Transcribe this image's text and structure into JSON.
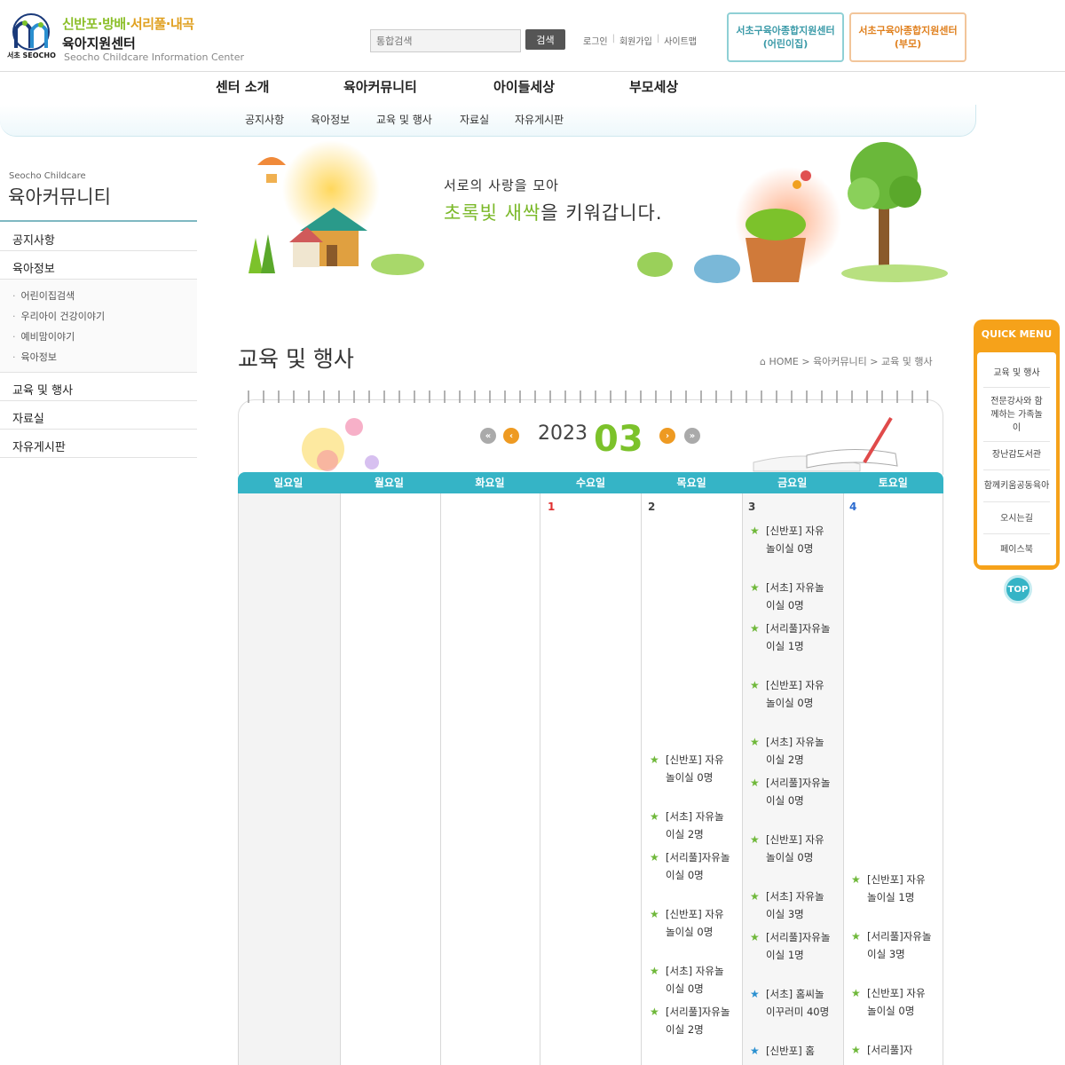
{
  "header": {
    "logo_tagline_a": "신반포·방배·",
    "logo_tagline_b": "서리풀·내곡",
    "logo_name": "육아지원센터",
    "logo_en": "Seocho Childcare Information Center",
    "logo_seocho": "서초 SEOCHO",
    "search_placeholder": "통합검색",
    "search_button": "검색",
    "links": [
      "로그인",
      "회원가입",
      "사이트맵"
    ],
    "center_buttons": [
      {
        "line1": "서초구육아종합지원센터",
        "line2": "(어린이집)",
        "color": "#3a9aa8"
      },
      {
        "line1": "서초구육아종합지원센터",
        "line2": "(부모)",
        "color": "#e0801e"
      }
    ]
  },
  "main_nav": [
    "센터 소개",
    "육아커뮤니티",
    "아이들세상",
    "부모세상"
  ],
  "sub_nav": [
    "공지사항",
    "육아정보",
    "교육 및 행사",
    "자료실",
    "자유게시판"
  ],
  "sidebar": {
    "en": "Seocho Childcare",
    "title": "육아커뮤니티",
    "items": [
      "공지사항",
      "육아정보",
      "교육 및 행사",
      "자료실",
      "자유게시판"
    ],
    "subitems": [
      "어린이집검색",
      "우리아이 건강이야기",
      "예비맘이야기",
      "육아정보"
    ]
  },
  "banner": {
    "line1": "서로의 사랑을 모아",
    "line2_hl": "초록빛 새싹",
    "line2_rest": "을 키워갑니다."
  },
  "page": {
    "title": "교육 및 행사",
    "breadcrumb": "HOME > 육아커뮤니티 > 교육 및 행사"
  },
  "calendar": {
    "year": "2023",
    "month": "03",
    "days": [
      "일요일",
      "월요일",
      "화요일",
      "수요일",
      "목요일",
      "금요일",
      "토요일"
    ],
    "dates": {
      "wed": "1",
      "thu": "2",
      "fri": "3",
      "sat": "4"
    },
    "thu_events": [
      {
        "text": "[신반포] 자유놀이실 0명",
        "star": "green"
      },
      {
        "text": "[서초] 자유놀이실 2명",
        "star": "green"
      },
      {
        "text": "[서리풀]자유놀이실 0명",
        "star": "green"
      },
      {
        "text": "[신반포] 자유놀이실 0명",
        "star": "green"
      },
      {
        "text": "[서초] 자유놀이실 0명",
        "star": "green"
      },
      {
        "text": "[서리풀]자유놀이실 2명",
        "star": "green"
      }
    ],
    "fri_events": [
      {
        "text": "[신반포] 자유놀이실 0명",
        "star": "green"
      },
      {
        "text": "[서초] 자유놀이실 0명",
        "star": "green"
      },
      {
        "text": "[서리풀]자유놀이실 1명",
        "star": "green"
      },
      {
        "text": "[신반포] 자유놀이실 0명",
        "star": "green"
      },
      {
        "text": "[서초] 자유놀이실 2명",
        "star": "green"
      },
      {
        "text": "[서리풀]자유놀이실 0명",
        "star": "green"
      },
      {
        "text": "[신반포] 자유놀이실 0명",
        "star": "green"
      },
      {
        "text": "[서초] 자유놀이실 3명",
        "star": "green"
      },
      {
        "text": "[서리풀]자유놀이실 1명",
        "star": "green"
      },
      {
        "text": "[서초] 홈씨놀이꾸러미 40명",
        "star": "blue"
      },
      {
        "text": "[신반포] 홈",
        "star": "blue"
      }
    ],
    "sat_events": [
      {
        "text": "[신반포] 자유놀이실 1명",
        "star": "green"
      },
      {
        "text": "[서리풀]자유놀이실 3명",
        "star": "green"
      },
      {
        "text": "[신반포] 자유놀이실 0명",
        "star": "green"
      },
      {
        "text": "[서리풀]자",
        "star": "green"
      }
    ]
  },
  "quick_menu": {
    "title": "QUICK MENU",
    "items": [
      "교육 및 행사",
      "전문강사와 함께하는 가족놀이",
      "장난감도서관",
      "함께키움공동육아",
      "오시는길",
      "페이스북"
    ],
    "top": "TOP"
  },
  "colors": {
    "accent": "#35b4c6",
    "green": "#7cc22b",
    "orange": "#f6a21a"
  }
}
